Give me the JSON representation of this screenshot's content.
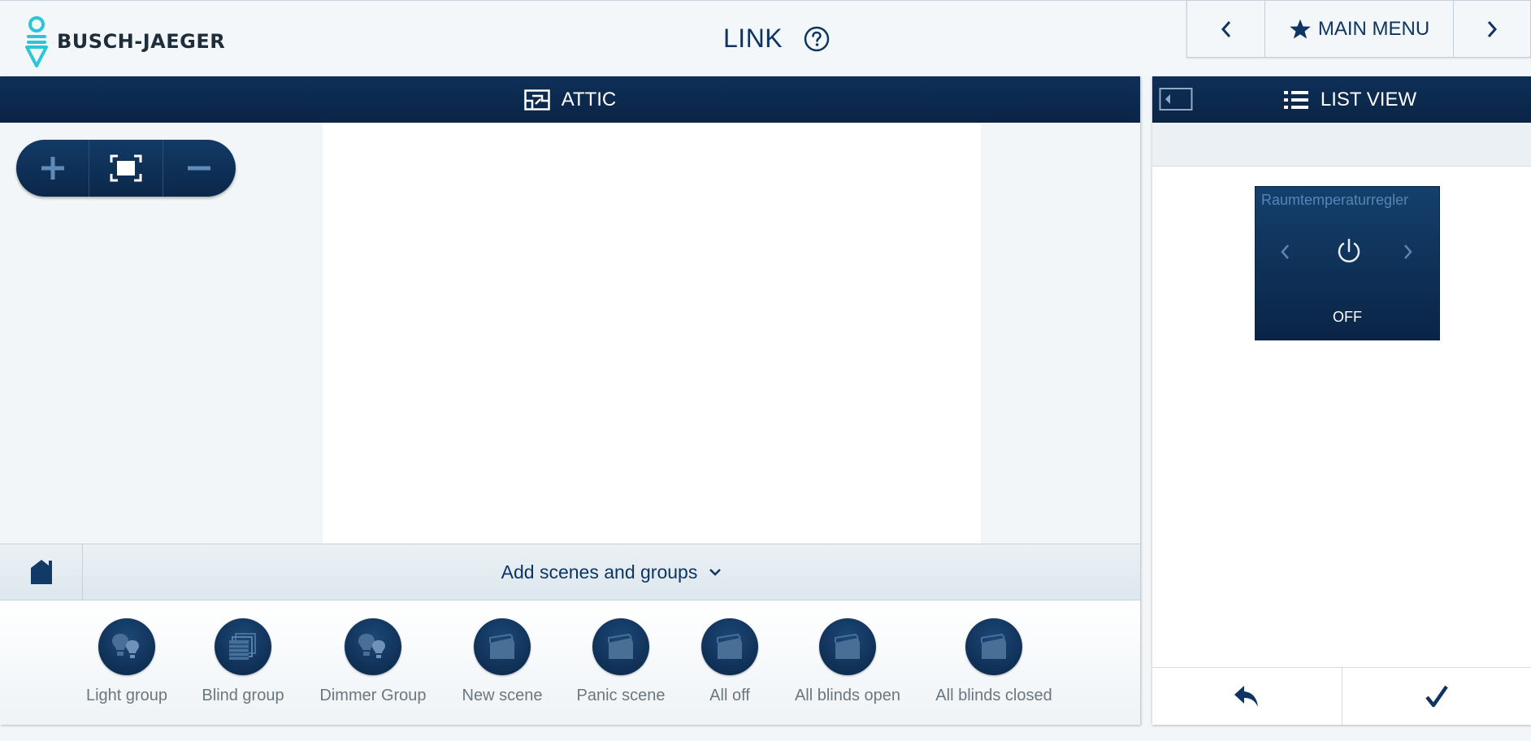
{
  "header": {
    "brand": "BUSCH-JAEGER",
    "title": "LINK",
    "main_menu_label": "MAIN MENU"
  },
  "floor": {
    "name": "ATTIC"
  },
  "add_bar": {
    "label": "Add scenes and groups"
  },
  "tray": {
    "items": [
      {
        "label": "Light group",
        "icon": "bulb-group-icon"
      },
      {
        "label": "Blind group",
        "icon": "blind-group-icon"
      },
      {
        "label": "Dimmer Group",
        "icon": "dimmer-group-icon"
      },
      {
        "label": "New scene",
        "icon": "clapperboard-icon"
      },
      {
        "label": "Panic scene",
        "icon": "clapperboard-icon"
      },
      {
        "label": "All off",
        "icon": "clapperboard-icon"
      },
      {
        "label": "All blinds open",
        "icon": "clapperboard-icon"
      },
      {
        "label": "All blinds closed",
        "icon": "clapperboard-icon"
      }
    ]
  },
  "list_view": {
    "title": "LIST VIEW",
    "tile": {
      "title": "Raumtemperaturregler",
      "status": "OFF"
    }
  },
  "colors": {
    "navy": "#0a2446",
    "accent_text": "#0e3561",
    "logo_cyan": "#2bc5d8"
  }
}
